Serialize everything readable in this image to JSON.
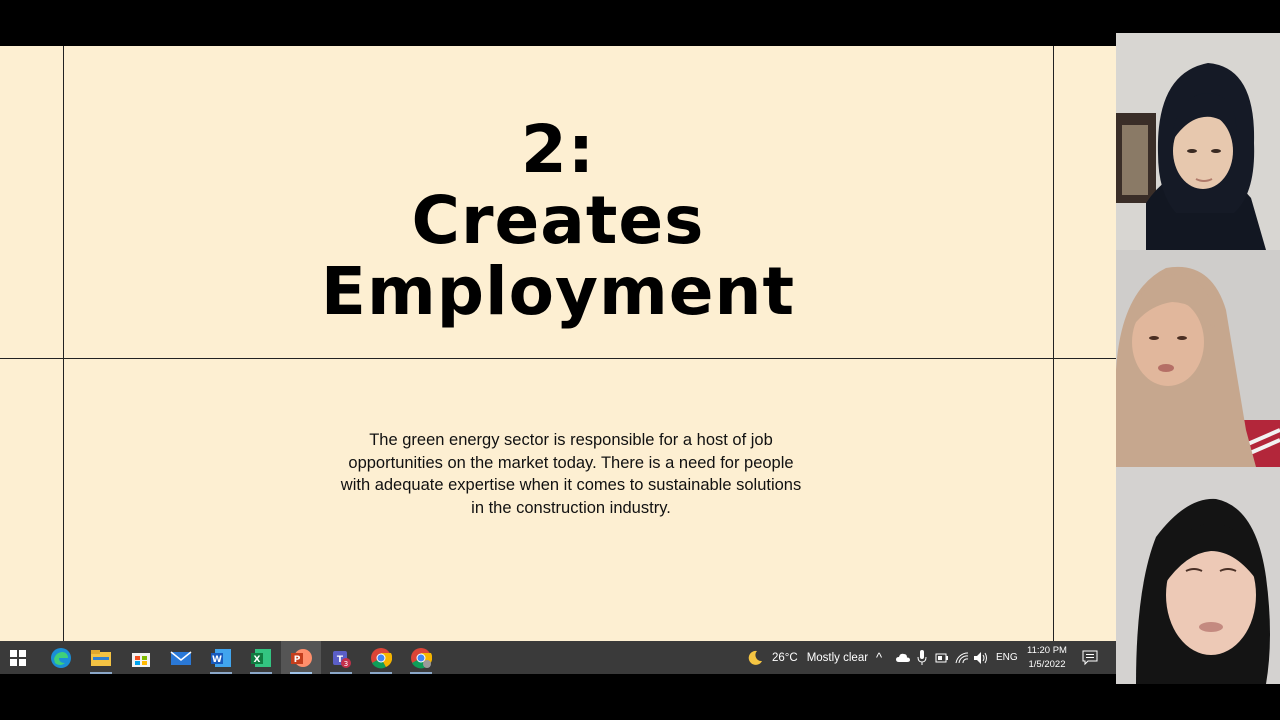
{
  "slide": {
    "title_lines": [
      "2:",
      "Creates",
      "Employment"
    ],
    "body_lines": [
      "The green energy sector is responsible for a host of job",
      "opportunities on the market today. There is a need for people",
      "with adequate expertise when it comes to sustainable solutions",
      "in the construction industry."
    ]
  },
  "taskbar": {
    "apps": [
      "start-icon",
      "edge-icon",
      "file-explorer-icon",
      "store-icon",
      "mail-icon",
      "word-icon",
      "excel-icon",
      "powerpoint-icon",
      "teams-icon",
      "chrome-icon",
      "chrome-alt-icon"
    ],
    "weather": {
      "temp": "26°C",
      "condition": "Mostly clear"
    },
    "language": "ENG",
    "time": "11:20 PM",
    "date": "1/5/2022",
    "teams_badge": "3"
  },
  "colors": {
    "slide_bg": "#fdefd2",
    "taskbar_bg": "#3a3a3a"
  }
}
